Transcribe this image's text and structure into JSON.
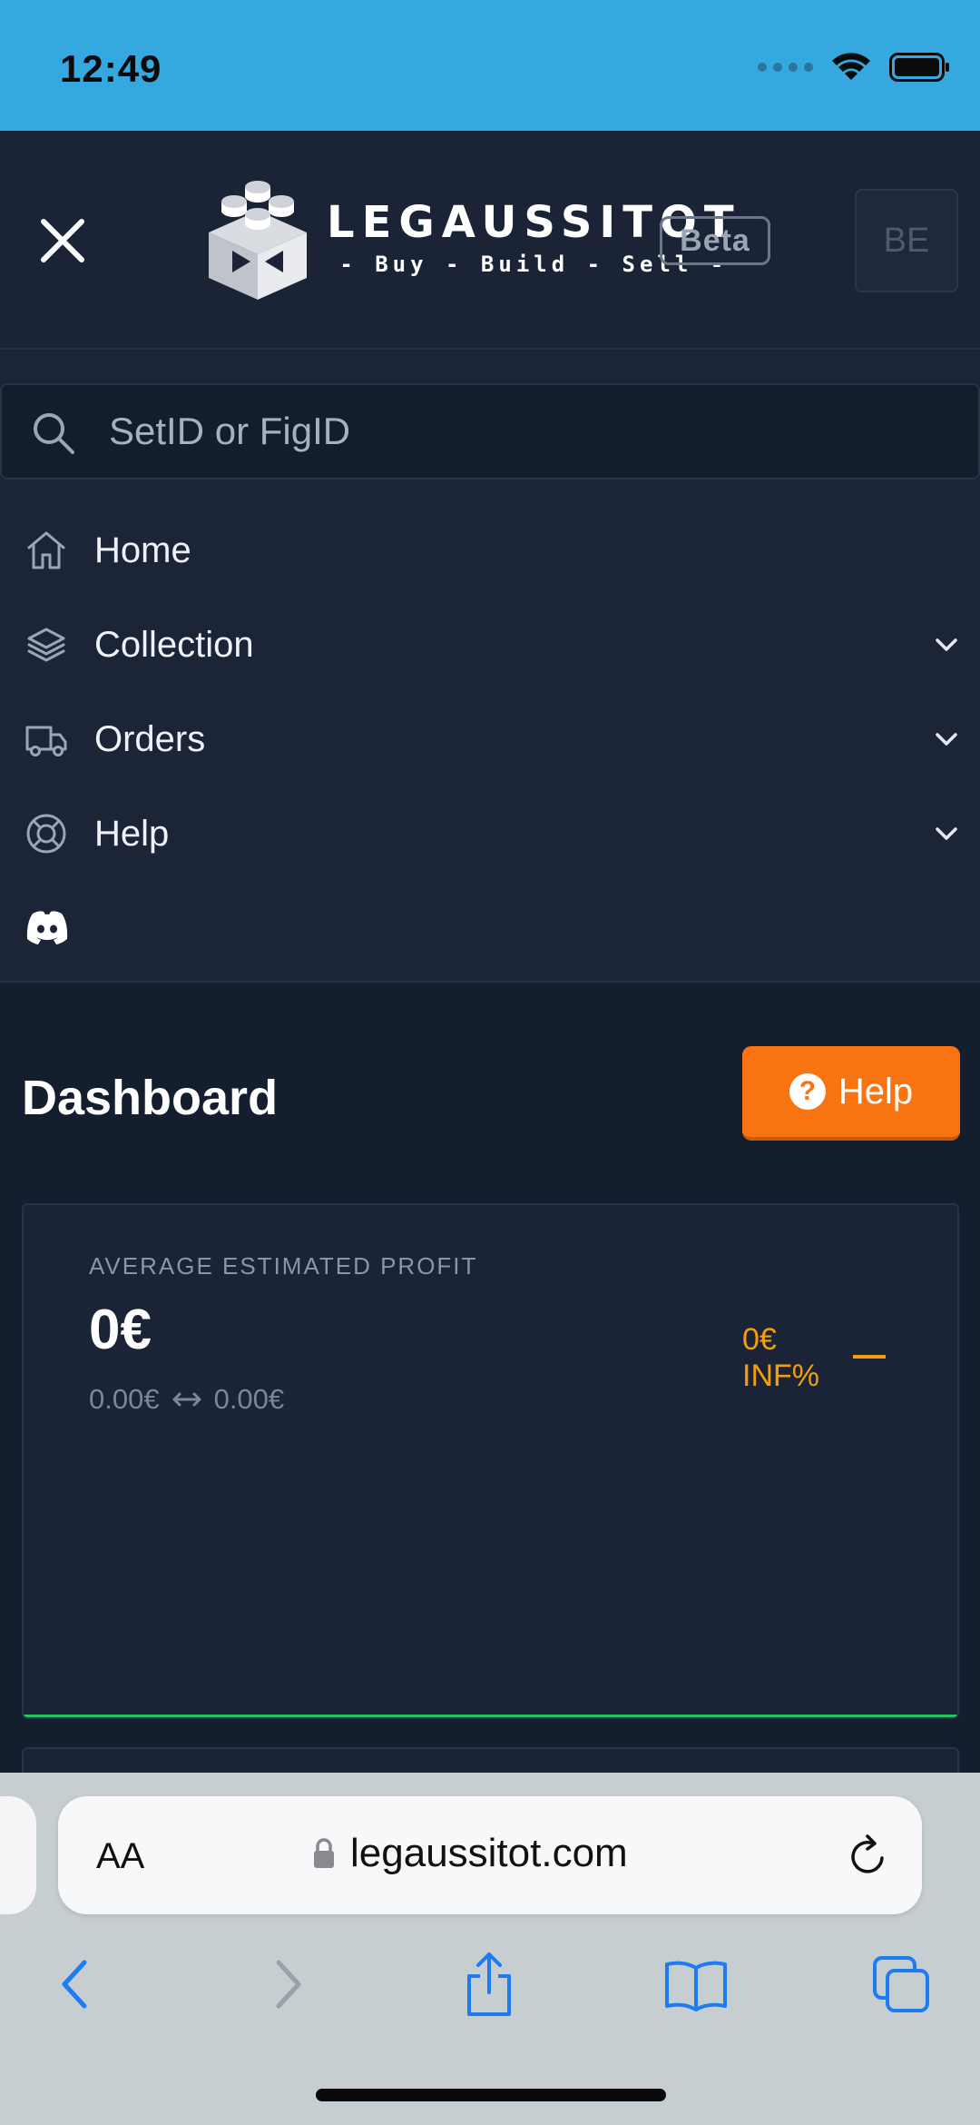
{
  "status_bar": {
    "time": "12:49"
  },
  "header": {
    "brand_name": "LEGAUSSITOT",
    "brand_tagline": "- Buy - Build - Sell -",
    "beta_label": "Beta",
    "language_label": "BE"
  },
  "search": {
    "placeholder": "SetID or FigID"
  },
  "nav": {
    "items": [
      {
        "label": "Home",
        "icon": "home-icon"
      },
      {
        "label": "Collection",
        "icon": "layers-icon"
      },
      {
        "label": "Orders",
        "icon": "truck-icon"
      },
      {
        "label": "Help",
        "icon": "lifebuoy-icon"
      }
    ],
    "discord_icon": "discord-icon"
  },
  "main": {
    "title": "Dashboard",
    "help_button": "Help",
    "card": {
      "label": "AVERAGE ESTIMATED PROFIT",
      "value": "0€",
      "range_from": "0.00€",
      "range_to": "0.00€",
      "change_amount": "0€",
      "change_percent": "INF%"
    }
  },
  "browser": {
    "aa_label": "AA",
    "url": "legaussitot.com"
  },
  "colors": {
    "status_bar": "#35a8e0",
    "background": "#1b2537",
    "accent_orange": "#f97311",
    "change_amber": "#f59e0b",
    "trend_green": "#22c55e"
  }
}
